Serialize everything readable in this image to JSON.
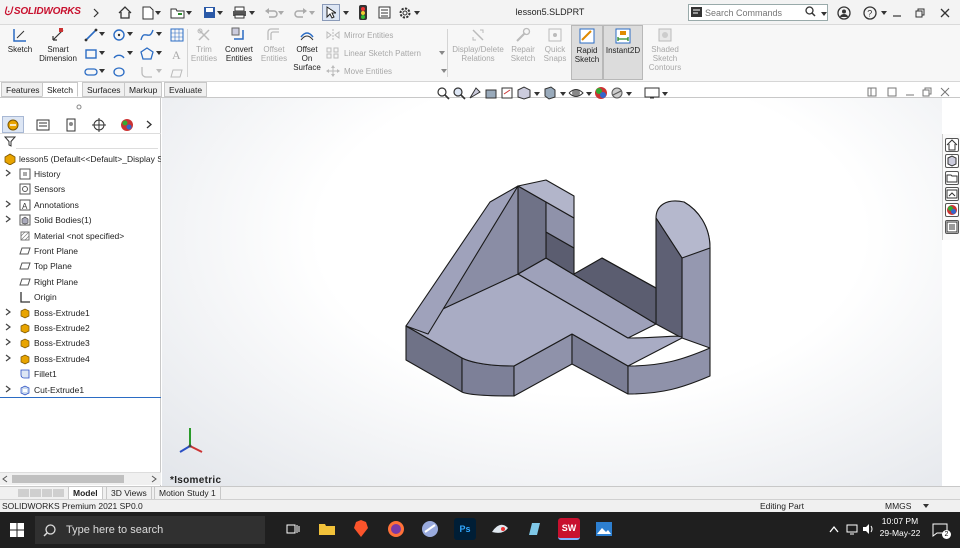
{
  "app": {
    "brand": "SOLIDWORKS",
    "document_title": "lesson5.SLDPRT"
  },
  "search": {
    "placeholder": "Search Commands"
  },
  "commands": {
    "sketch": "Sketch",
    "smart_dimension": [
      "Smart",
      "Dimension"
    ],
    "trim_entities": [
      "Trim",
      "Entities"
    ],
    "convert_entities": [
      "Convert",
      "Entities"
    ],
    "offset_entities": [
      "Offset",
      "Entities"
    ],
    "offset_on_surface": [
      "Offset",
      "On",
      "Surface"
    ],
    "mirror_entities": "Mirror Entities",
    "linear_sketch_pattern": "Linear Sketch Pattern",
    "move_entities": "Move Entities",
    "display_delete_relations": [
      "Display/Delete",
      "Relations"
    ],
    "repair_sketch": [
      "Repair",
      "Sketch"
    ],
    "quick_snaps": [
      "Quick",
      "Snaps"
    ],
    "rapid_sketch": [
      "Rapid",
      "Sketch"
    ],
    "instant2d": "Instant2D",
    "shaded_sketch_contours": [
      "Shaded",
      "Sketch",
      "Contours"
    ]
  },
  "tabs": [
    "Features",
    "Sketch",
    "Surfaces",
    "Markup",
    "Evaluate"
  ],
  "active_tab": "Sketch",
  "tree": {
    "root": "lesson5  (Default<<Default>_Display S",
    "items": [
      {
        "label": "History",
        "expandable": true,
        "icon": "history-icon"
      },
      {
        "label": "Sensors",
        "expandable": false,
        "icon": "sensors-icon"
      },
      {
        "label": "Annotations",
        "expandable": true,
        "icon": "annotations-icon"
      },
      {
        "label": "Solid Bodies(1)",
        "expandable": true,
        "icon": "solid-bodies-icon"
      },
      {
        "label": "Material <not specified>",
        "expandable": false,
        "icon": "material-icon"
      },
      {
        "label": "Front Plane",
        "expandable": false,
        "icon": "plane-icon"
      },
      {
        "label": "Top Plane",
        "expandable": false,
        "icon": "plane-icon"
      },
      {
        "label": "Right Plane",
        "expandable": false,
        "icon": "plane-icon"
      },
      {
        "label": "Origin",
        "expandable": false,
        "icon": "origin-icon"
      },
      {
        "label": "Boss-Extrude1",
        "expandable": true,
        "icon": "extrude-icon"
      },
      {
        "label": "Boss-Extrude2",
        "expandable": true,
        "icon": "extrude-icon"
      },
      {
        "label": "Boss-Extrude3",
        "expandable": true,
        "icon": "extrude-icon"
      },
      {
        "label": "Boss-Extrude4",
        "expandable": true,
        "icon": "extrude-icon"
      },
      {
        "label": "Fillet1",
        "expandable": false,
        "icon": "fillet-icon"
      },
      {
        "label": "Cut-Extrude1",
        "expandable": true,
        "icon": "cut-extrude-icon"
      }
    ]
  },
  "viewport": {
    "view_label": "*Isometric"
  },
  "bottom_tabs": [
    "Model",
    "3D Views",
    "Motion Study 1"
  ],
  "active_bottom_tab": "Model",
  "status": {
    "left": "SOLIDWORKS Premium 2021 SP0.0",
    "mode": "Editing Part",
    "units": "MMGS"
  },
  "taskbar": {
    "search_placeholder": "Type here to search",
    "time": "10:07 PM",
    "date": "29-May-22",
    "notifications": "2"
  },
  "colors": {
    "brand_red": "#c8102e",
    "part_face_light": "#a9acc4",
    "part_face_mid": "#8d90a8",
    "part_face_dark": "#5e6074",
    "part_edge": "#1a1a1a"
  }
}
